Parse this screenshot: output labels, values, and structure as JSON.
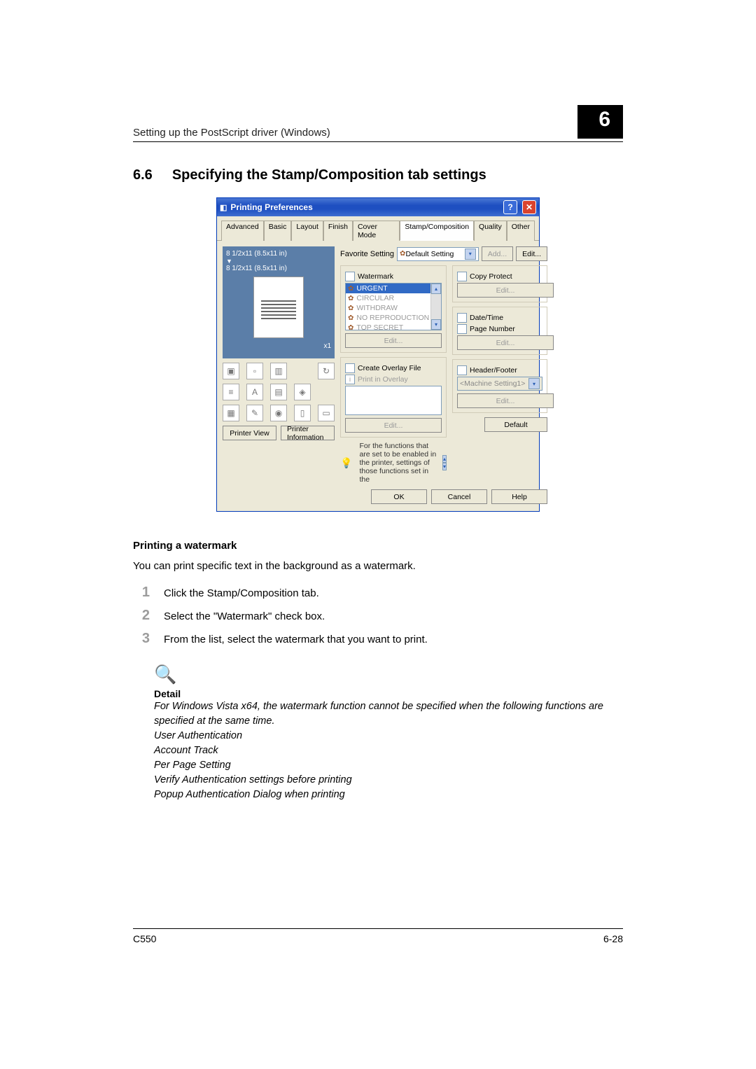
{
  "header": {
    "breadcrumb": "Setting up the PostScript driver (Windows)",
    "chapter": "6"
  },
  "section": {
    "number": "6.6",
    "title": "Specifying the Stamp/Composition tab settings"
  },
  "dialog": {
    "title": "Printing Preferences",
    "tabs": [
      "Advanced",
      "Basic",
      "Layout",
      "Finish",
      "Cover Mode",
      "Stamp/Composition",
      "Quality",
      "Other"
    ],
    "active_tab": 5,
    "favorite_label": "Favorite Setting",
    "favorite_value": "Default Setting",
    "add_btn": "Add...",
    "edit_btn": "Edit...",
    "paper_dim1": "8 1/2x11 (8.5x11 in)",
    "paper_dim2": "8 1/2x11 (8.5x11 in)",
    "nup": "x1",
    "watermark": {
      "label": "Watermark",
      "items": [
        "URGENT",
        "CIRCULAR",
        "WITHDRAW",
        "NO REPRODUCTION",
        "TOP SECRET"
      ],
      "edit": "Edit..."
    },
    "overlay": {
      "create": "Create Overlay File",
      "print": "Print in Overlay",
      "edit": "Edit..."
    },
    "copyprotect": {
      "label": "Copy Protect",
      "edit": "Edit..."
    },
    "datetime": "Date/Time",
    "pagenum": "Page Number",
    "dt_edit": "Edit...",
    "headerfooter": {
      "label": "Header/Footer",
      "value": "<Machine Setting1>",
      "edit": "Edit..."
    },
    "info_text": "For the functions that are set to be enabled in the printer, settings of those functions set in the",
    "printer_view": "Printer View",
    "printer_info": "Printer Information",
    "default_btn": "Default",
    "ok": "OK",
    "cancel": "Cancel",
    "help": "Help"
  },
  "subsection": {
    "title": "Printing a watermark",
    "intro": "You can print specific text in the background as a watermark.",
    "steps": [
      "Click the Stamp/Composition tab.",
      "Select the \"Watermark\" check box.",
      "From the list, select the watermark that you want to print."
    ]
  },
  "detail": {
    "heading": "Detail",
    "lines": [
      "For Windows Vista x64, the watermark function cannot be specified when the following functions are specified at the same time.",
      "User Authentication",
      "Account Track",
      "Per Page Setting",
      "Verify Authentication settings before printing",
      "Popup Authentication Dialog when printing"
    ]
  },
  "footer": {
    "model": "C550",
    "page": "6-28"
  }
}
